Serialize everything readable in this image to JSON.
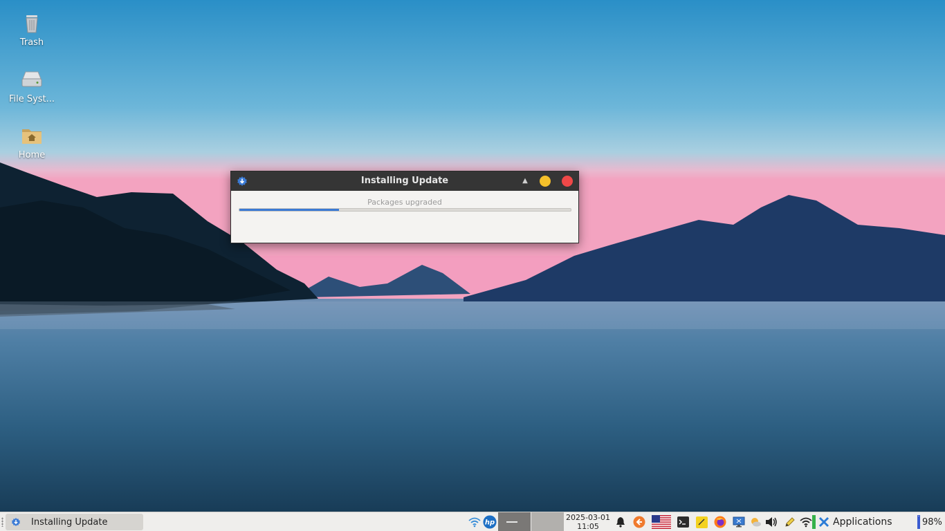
{
  "desktop": {
    "icons": [
      {
        "label": "Trash",
        "icon": "trash-icon"
      },
      {
        "label": "File Syst...",
        "icon": "drive-icon"
      },
      {
        "label": "Home",
        "icon": "home-folder-icon"
      }
    ]
  },
  "dialog": {
    "title": "Installing Update",
    "status": "Packages upgraded",
    "progress_percent": 30,
    "colors": {
      "titlebar": "#353535",
      "minimize": "#f5c02a",
      "close": "#ef4848",
      "progress": "#3a7ad4"
    }
  },
  "taskbar": {
    "window_button_label": "Installing Update",
    "clock_date": "2025-03-01",
    "clock_time": "11:05",
    "applications_label": "Applications",
    "battery_percent": "98%",
    "tray_icons": [
      "wifi-icon",
      "hp-icon",
      "notification-bell-icon",
      "back-arrow-icon",
      "us-flag-icon",
      "terminal-icon",
      "notes-icon",
      "firefox-icon",
      "display-icon",
      "weather-icon",
      "volume-icon",
      "pencil-icon",
      "wifi-icon",
      "green-indicator-icon"
    ]
  }
}
